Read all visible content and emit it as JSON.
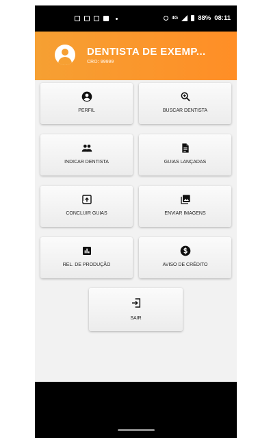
{
  "status_bar": {
    "battery": "88%",
    "time": "08:11",
    "network": "4G"
  },
  "header": {
    "title": "DENTISTA DE EXEMP...",
    "subtitle": "CRO: 99999"
  },
  "menu": {
    "perfil": "PERFIL",
    "buscar": "BUSCAR DENTISTA",
    "indicar": "INDICAR DENTISTA",
    "guias_lancadas": "GUIAS LANÇADAS",
    "concluir": "CONCLUIR GUIAS",
    "enviar": "ENVIAR IMAGENS",
    "rel_producao": "REL. DE PRODUÇÃO",
    "aviso": "AVISO DE CRÉDITO",
    "sair": "SAIR"
  },
  "colors": {
    "header_start": "#f6a033",
    "header_end": "#ff8e26",
    "icon": "#111111"
  },
  "icons": {
    "perfil": "account-circle-icon",
    "buscar": "zoom-in-icon",
    "indicar": "people-icon",
    "guias_lancadas": "document-icon",
    "concluir": "exit-to-app-box-icon",
    "enviar": "photo-library-icon",
    "rel_producao": "bar-chart-icon",
    "aviso": "dollar-circle-icon",
    "sair": "logout-icon"
  }
}
